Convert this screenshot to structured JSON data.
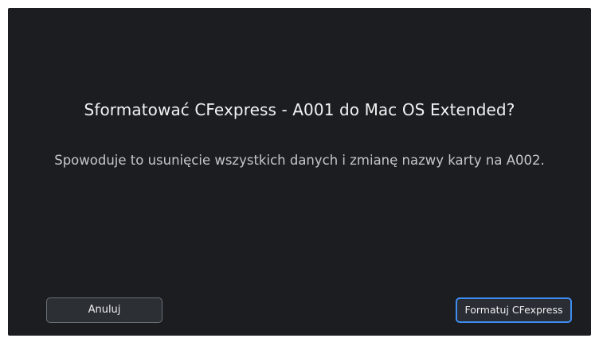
{
  "dialog": {
    "title": "Sformatować CFexpress - A001 do Mac OS Extended?",
    "message": "Spowoduje to usunięcie wszystkich danych i zmianę nazwy karty na A002."
  },
  "buttons": {
    "cancel_label": "Anuluj",
    "confirm_label": "Formatuj CFexpress"
  },
  "colors": {
    "background": "#1b1d21",
    "focus_accent": "#3f8df3"
  }
}
